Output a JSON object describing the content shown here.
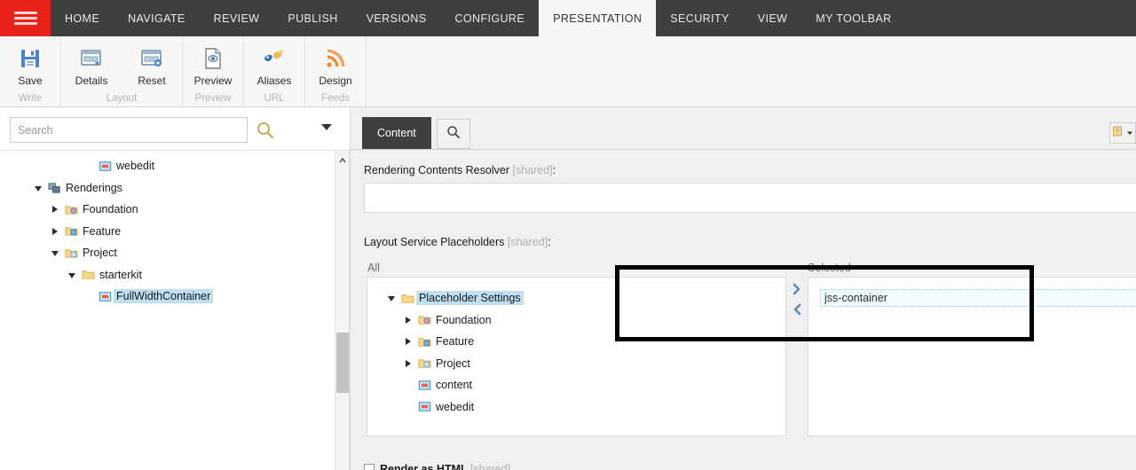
{
  "topbar": {
    "menu_icon": "hamburger-icon",
    "tabs": [
      {
        "label": "HOME",
        "active": false
      },
      {
        "label": "NAVIGATE",
        "active": false
      },
      {
        "label": "REVIEW",
        "active": false
      },
      {
        "label": "PUBLISH",
        "active": false
      },
      {
        "label": "VERSIONS",
        "active": false
      },
      {
        "label": "CONFIGURE",
        "active": false
      },
      {
        "label": "PRESENTATION",
        "active": true
      },
      {
        "label": "SECURITY",
        "active": false
      },
      {
        "label": "VIEW",
        "active": false
      },
      {
        "label": "MY TOOLBAR",
        "active": false
      }
    ]
  },
  "ribbon": {
    "groups": [
      {
        "label": "Write",
        "items": [
          {
            "label": "Save",
            "icon": "save-floppy-icon"
          }
        ]
      },
      {
        "label": "Layout",
        "items": [
          {
            "label": "Details",
            "icon": "layout-details-icon"
          },
          {
            "label": "Reset",
            "icon": "layout-reset-icon"
          }
        ]
      },
      {
        "label": "Preview",
        "items": [
          {
            "label": "Preview",
            "icon": "preview-document-icon"
          }
        ]
      },
      {
        "label": "URL",
        "items": [
          {
            "label": "Aliases",
            "icon": "aliases-masks-icon"
          }
        ]
      },
      {
        "label": "Feeds",
        "items": [
          {
            "label": "Design",
            "icon": "rss-feed-icon"
          }
        ]
      }
    ]
  },
  "search": {
    "placeholder": "Search",
    "value": "",
    "magnifier_icon": "search-icon",
    "caret_icon": "chevron-down-icon"
  },
  "content_tree": {
    "nodes": [
      {
        "label": "webedit",
        "indent": 4,
        "expander": "none",
        "icon": "placeholder-item-icon",
        "selected": false
      },
      {
        "label": "Renderings",
        "indent": 1,
        "expander": "down",
        "icon": "renderings-icon",
        "selected": false
      },
      {
        "label": "Foundation",
        "indent": 2,
        "expander": "right",
        "icon": "folder-foundation-icon",
        "selected": false
      },
      {
        "label": "Feature",
        "indent": 2,
        "expander": "right",
        "icon": "folder-feature-icon",
        "selected": false
      },
      {
        "label": "Project",
        "indent": 2,
        "expander": "down",
        "icon": "folder-project-icon",
        "selected": false
      },
      {
        "label": "starterkit",
        "indent": 3,
        "expander": "down",
        "icon": "folder-icon",
        "selected": false
      },
      {
        "label": "FullWidthContainer",
        "indent": 4,
        "expander": "none",
        "icon": "rendering-item-icon",
        "selected": true
      }
    ],
    "scrollbar": {
      "up_arrow_icon": "chevron-up-icon"
    }
  },
  "right_panel": {
    "tabs": [
      {
        "label": "Content",
        "active": true
      },
      {
        "label": "",
        "icon": "search-icon",
        "active": false
      }
    ],
    "corner_button_icon": "properties-icon",
    "fields": {
      "resolver": {
        "label": "Rendering Contents Resolver",
        "shared_tag": "[shared]",
        "suffix": ":",
        "value": ""
      },
      "placeholders": {
        "label": "Layout Service Placeholders",
        "shared_tag": "[shared]",
        "suffix": ":",
        "all_header": "All",
        "selected_header": "Selected",
        "all_items": [
          {
            "label": "Placeholder Settings",
            "indent": 0,
            "expander": "down",
            "icon": "folder-icon",
            "selected": true
          },
          {
            "label": "Foundation",
            "indent": 1,
            "expander": "right",
            "icon": "folder-foundation-icon",
            "selected": false
          },
          {
            "label": "Feature",
            "indent": 1,
            "expander": "right",
            "icon": "folder-feature-icon",
            "selected": false
          },
          {
            "label": "Project",
            "indent": 1,
            "expander": "right",
            "icon": "folder-project-icon",
            "selected": false
          },
          {
            "label": "content",
            "indent": 1,
            "expander": "none",
            "icon": "placeholder-item-icon",
            "selected": false
          },
          {
            "label": "webedit",
            "indent": 1,
            "expander": "none",
            "icon": "placeholder-item-icon",
            "selected": false
          }
        ],
        "selected_items": [
          "jss-container"
        ],
        "move_right_icon": "chevron-right-icon",
        "move_left_icon": "chevron-left-icon"
      },
      "render_as_html": {
        "label": "Render as HTML",
        "shared_tag": "[shared]",
        "checked": false
      }
    }
  },
  "annotation": {
    "type": "highlight-rectangle",
    "color": "#000000"
  }
}
